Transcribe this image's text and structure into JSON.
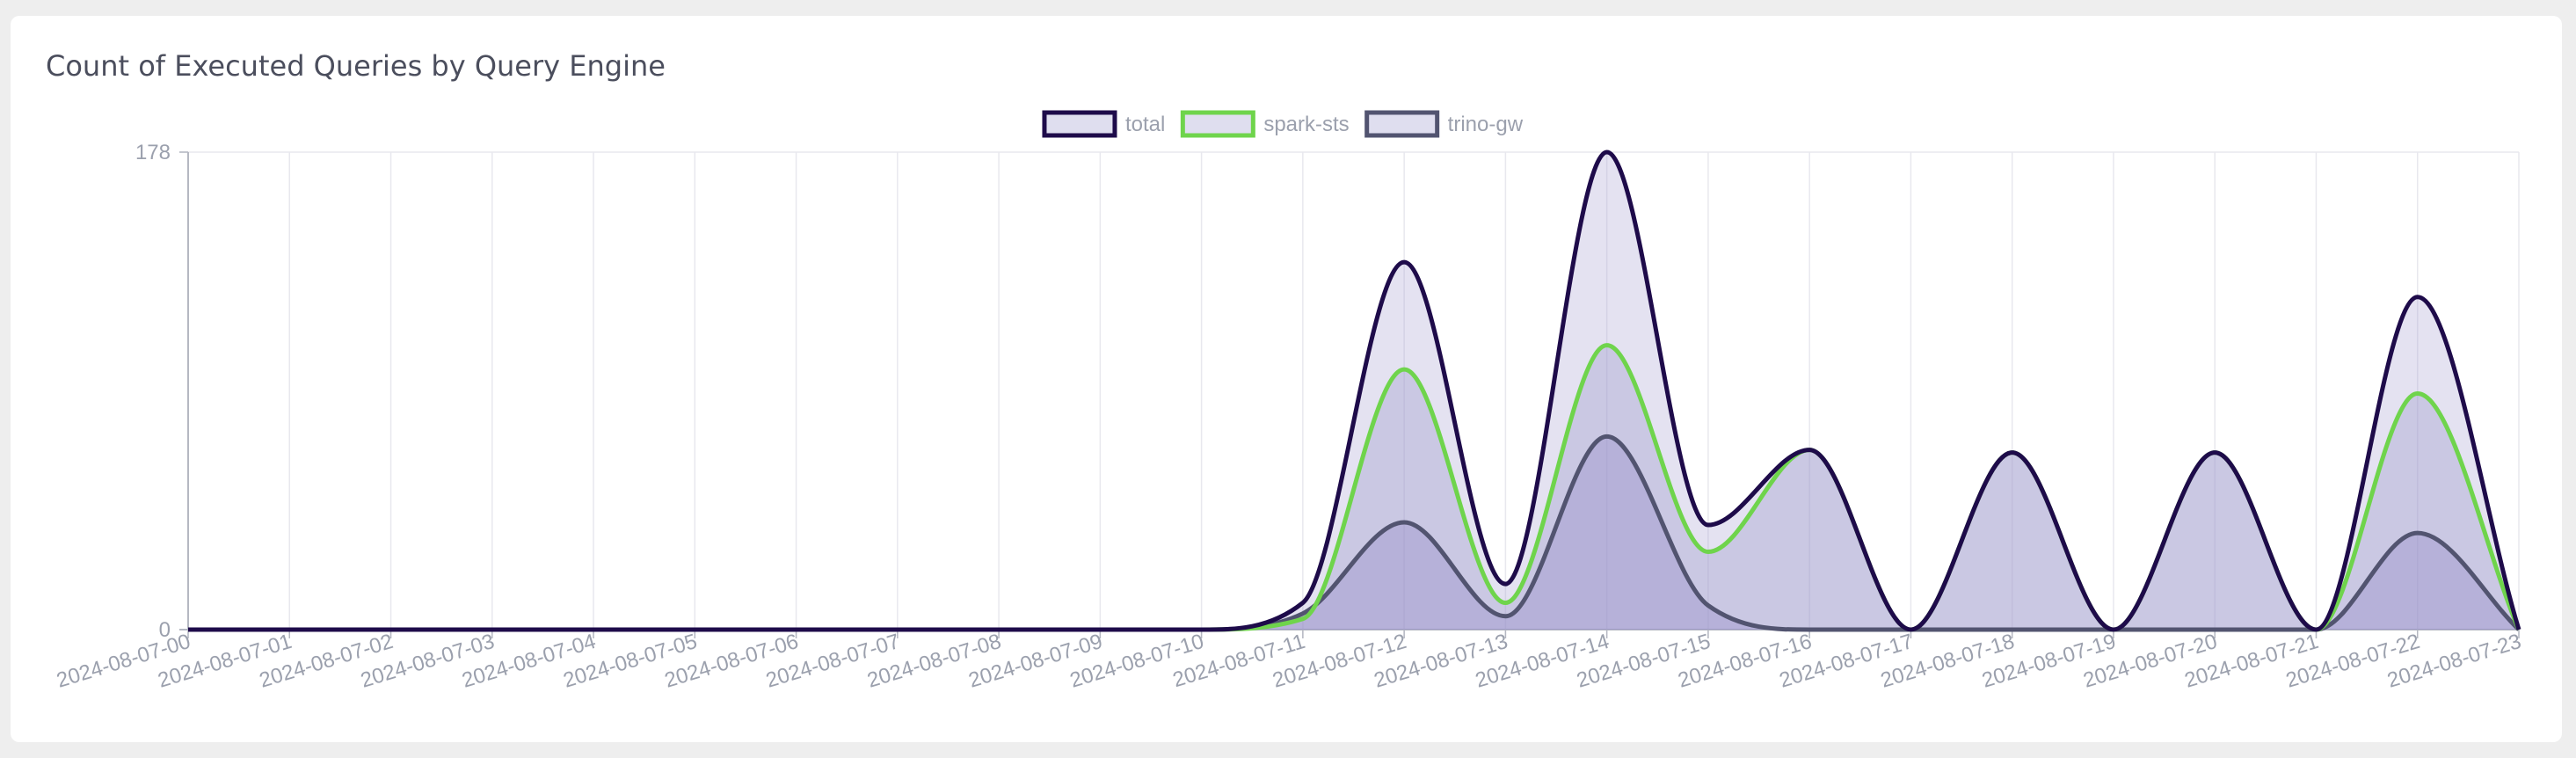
{
  "card": {
    "title": "Count of Executed Queries by Query Engine"
  },
  "chart_data": {
    "type": "area",
    "title": "Count of Executed Queries by Query Engine",
    "xlabel": "",
    "ylabel": "",
    "categories": [
      "2024-08-07-00",
      "2024-08-07-01",
      "2024-08-07-02",
      "2024-08-07-03",
      "2024-08-07-04",
      "2024-08-07-05",
      "2024-08-07-06",
      "2024-08-07-07",
      "2024-08-07-08",
      "2024-08-07-09",
      "2024-08-07-10",
      "2024-08-07-11",
      "2024-08-07-12",
      "2024-08-07-13",
      "2024-08-07-14",
      "2024-08-07-15",
      "2024-08-07-16",
      "2024-08-07-17",
      "2024-08-07-18",
      "2024-08-07-19",
      "2024-08-07-20",
      "2024-08-07-21",
      "2024-08-07-22",
      "2024-08-07-23"
    ],
    "ylim": [
      0,
      178
    ],
    "yticks": [
      "0",
      "178"
    ],
    "grid": true,
    "legend_position": "top-center",
    "series": [
      {
        "name": "total",
        "stroke": "#1e0b4a",
        "fill": "rgba(170,165,210,0.32)",
        "values": [
          0,
          0,
          0,
          0,
          0,
          0,
          0,
          0,
          0,
          0,
          0,
          10,
          137,
          17,
          178,
          39,
          67,
          0,
          66,
          0,
          66,
          0,
          124,
          0
        ]
      },
      {
        "name": "spark-sts",
        "stroke": "#6fd44c",
        "fill": "rgba(150,145,200,0.32)",
        "values": [
          0,
          0,
          0,
          0,
          0,
          0,
          0,
          0,
          0,
          0,
          0,
          4,
          97,
          10,
          106,
          29,
          67,
          0,
          66,
          0,
          66,
          0,
          88,
          0
        ]
      },
      {
        "name": "trino-gw",
        "stroke": "#525470",
        "fill": "rgba(140,130,195,0.32)",
        "values": [
          0,
          0,
          0,
          0,
          0,
          0,
          0,
          0,
          0,
          0,
          0,
          6,
          40,
          5,
          72,
          9,
          0,
          0,
          0,
          0,
          0,
          0,
          36,
          0
        ]
      }
    ]
  }
}
